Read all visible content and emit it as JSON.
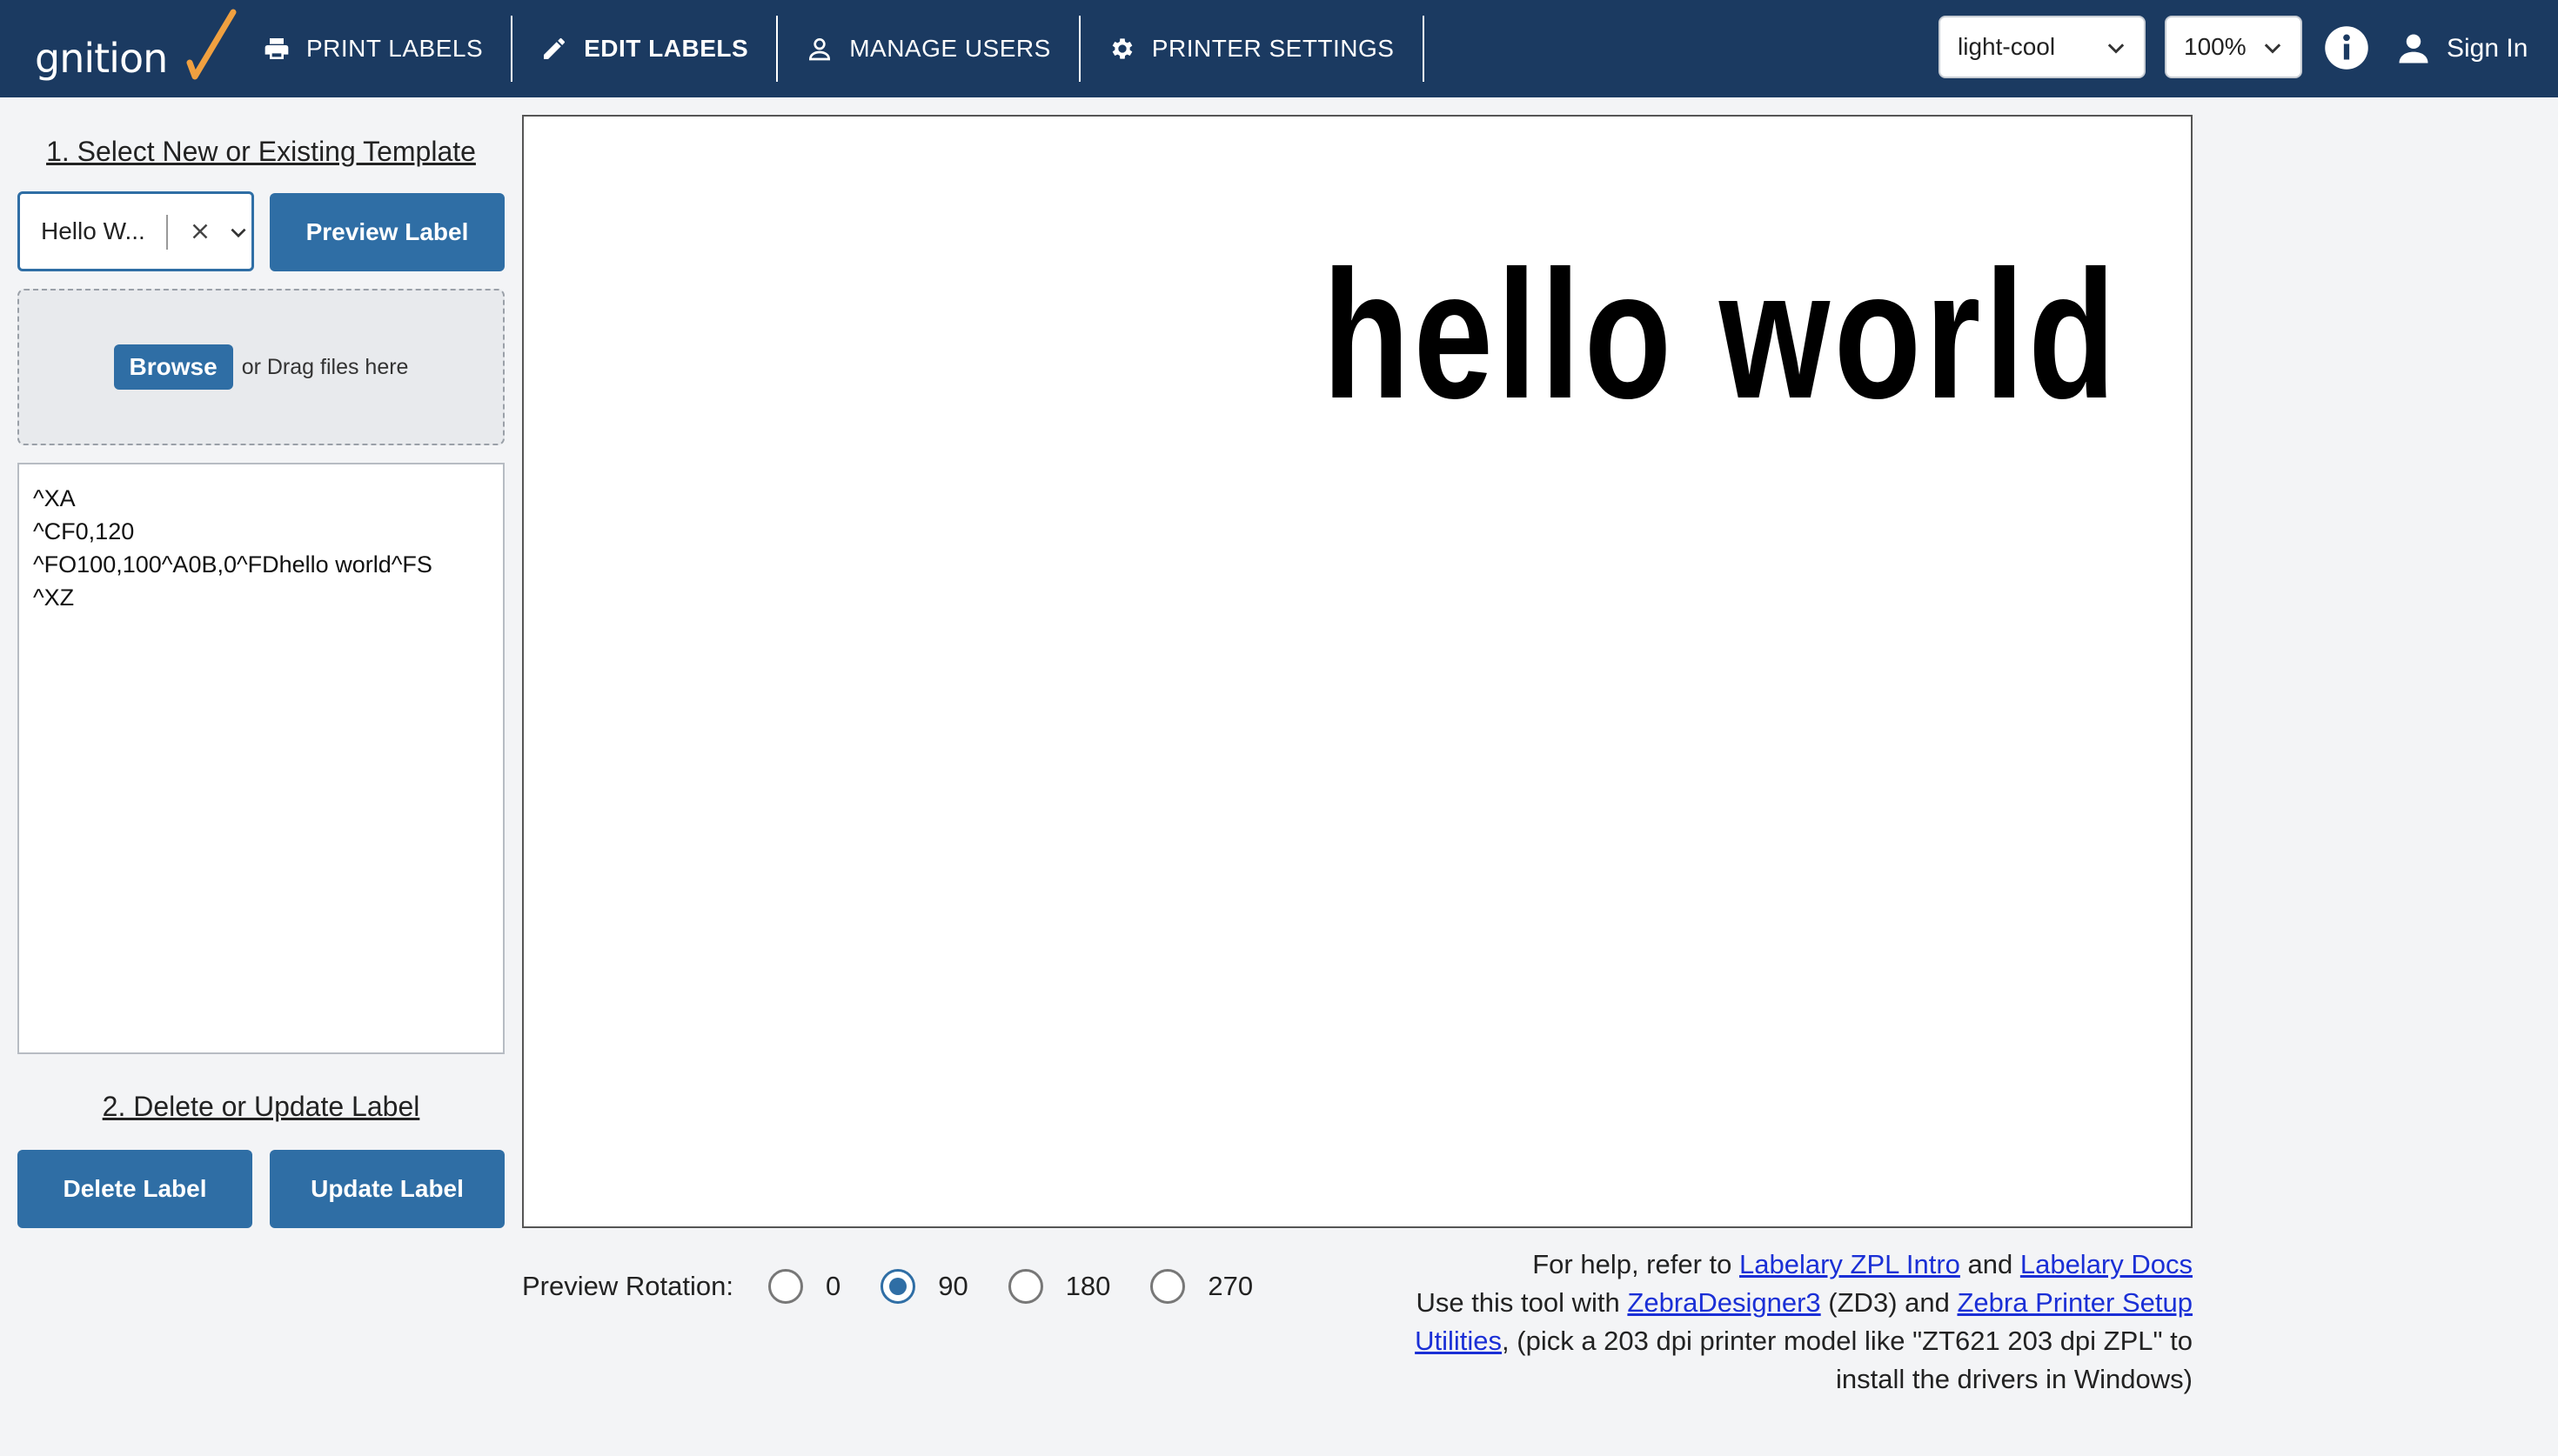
{
  "header": {
    "logo_text": "gnition",
    "nav": [
      {
        "label": "PRINT LABELS",
        "active": false
      },
      {
        "label": "EDIT LABELS",
        "active": true
      },
      {
        "label": "MANAGE USERS",
        "active": false
      },
      {
        "label": "PRINTER SETTINGS",
        "active": false
      }
    ],
    "theme_select": "light-cool",
    "zoom_select": "100%",
    "sign_in": "Sign In"
  },
  "left_panel": {
    "section1_title": "1. Select New or Existing Template",
    "template_value": "Hello W...",
    "preview_button": "Preview Label",
    "browse_button": "Browse",
    "drag_text": "or Drag files here",
    "zpl_code": "^XA\n^CF0,120\n^FO100,100^A0B,0^FDhello world^FS\n^XZ",
    "section2_title": "2. Delete or Update Label",
    "delete_button": "Delete Label",
    "update_button": "Update Label"
  },
  "preview": {
    "label_text": "hello world"
  },
  "rotation": {
    "label": "Preview Rotation:",
    "options": [
      "0",
      "90",
      "180",
      "270"
    ],
    "selected": "90"
  },
  "help": {
    "line1_prefix": "For help, refer to ",
    "link_zpl_intro": "Labelary ZPL Intro",
    "and1": " and ",
    "link_docs": "Labelary Docs",
    "line2_prefix": "Use this tool with ",
    "link_zd3": "ZebraDesigner3",
    "line2_mid": " (ZD3) and ",
    "link_zebra_setup": "Zebra Printer Setup Utilities",
    "line2_suffix": ", (pick a 203 dpi printer model like \"ZT621 203 dpi ZPL\" to install the drivers in Windows)"
  },
  "colors": {
    "header_bg": "#1b3a61",
    "accent": "#2f6ea5",
    "logo_check": "#f0a040",
    "link": "#1a2fd6"
  }
}
